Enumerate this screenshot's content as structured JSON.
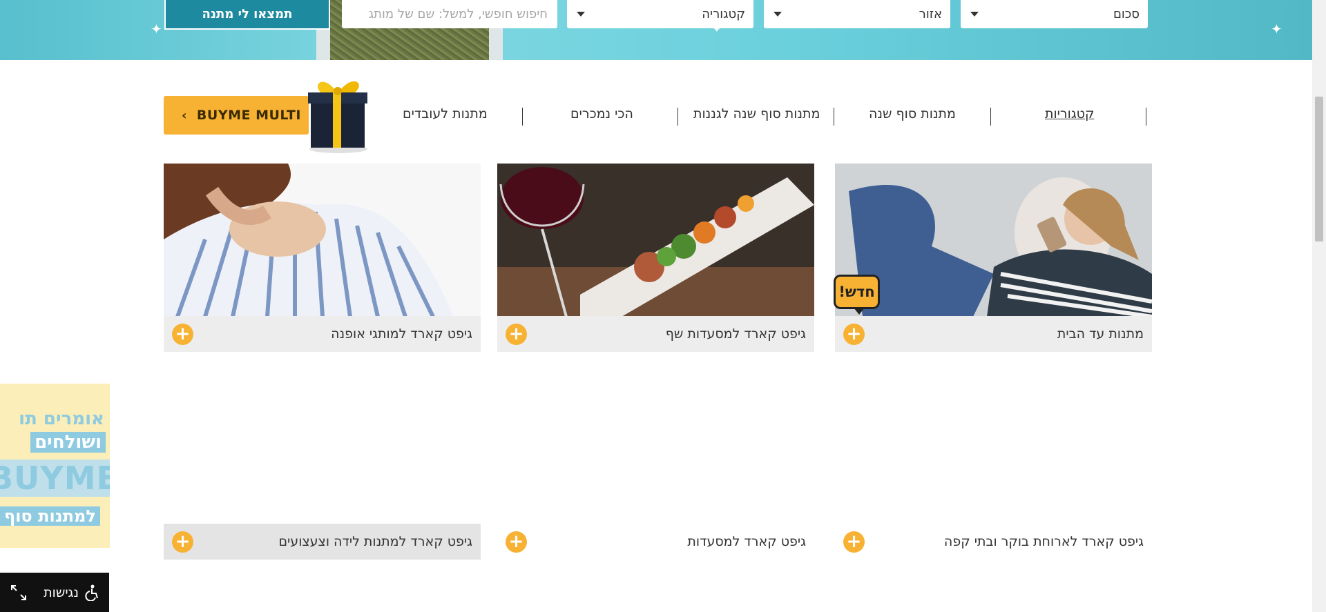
{
  "search": {
    "find_button": "תמצאו לי מתנה",
    "amount_select": "סכום",
    "area_select": "אזור",
    "category_select": "קטגוריה",
    "free_search_placeholder": "חיפוש חופשי, למשל: שם של מותג"
  },
  "nav": {
    "items": [
      "קטגוריות",
      "מתנות סוף שנה",
      "מתנות סוף שנה לגננות",
      "הכי נמכרים",
      "מתנות לעובדים"
    ],
    "multi_button": "BUYME MULTI"
  },
  "cards": [
    {
      "caption": "מתנות עד הבית",
      "badge": "חדש!"
    },
    {
      "caption": "גיפט קארד למסעדות שף"
    },
    {
      "caption": "גיפט קארד למותגי אופנה"
    },
    {
      "caption": "גיפט קארד לארוחת בוקר ובתי קפה"
    },
    {
      "caption": "גיפט קארד למסעדות"
    },
    {
      "caption": "גיפט קארד למתנות לידה וצעצועים"
    }
  ],
  "side_promo": {
    "line1": "אומרים תו",
    "line2": "ושולחים",
    "line3": "BUYME",
    "line4": "למתנות סוף"
  },
  "accessibility": {
    "label": "נגישות"
  },
  "colors": {
    "accent": "#f7b233",
    "banner": "#5fc6d3",
    "find_button": "#1e8aa0"
  },
  "icons": {
    "plus": "plus-icon",
    "caret": "caret-down-icon",
    "accessibility": "wheelchair-icon",
    "expand": "expand-icon"
  }
}
